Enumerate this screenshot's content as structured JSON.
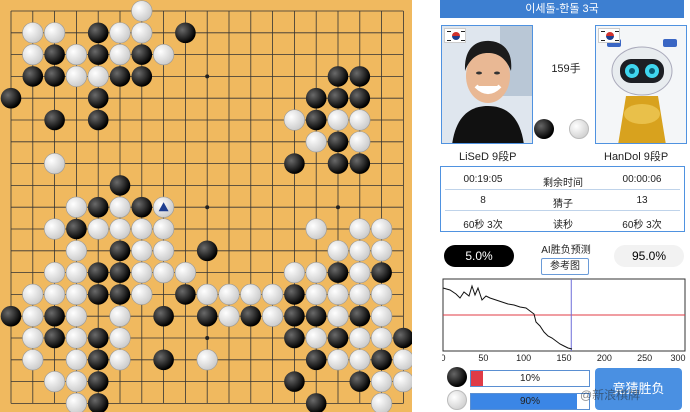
{
  "header": {
    "title": "이세돌-한돌 3국"
  },
  "move": {
    "label": "159手"
  },
  "players": {
    "black": {
      "name": "LiSeD 9段P"
    },
    "white": {
      "name": "HanDol 9段P"
    }
  },
  "stats": {
    "rows": [
      {
        "left": "00:19:05",
        "label": "剩余时间",
        "right": "00:00:06"
      },
      {
        "left": "8",
        "label": "猜子",
        "right": "13"
      },
      {
        "left": "60秒 3次",
        "label": "读秒",
        "right": "60秒 3次"
      }
    ]
  },
  "ai": {
    "title": "AI胜负预测",
    "ref_button": "参考图",
    "black_pct": "5.0%",
    "white_pct": "95.0%"
  },
  "graph": {
    "x_ticks": [
      "0",
      "50",
      "100",
      "150",
      "200",
      "250",
      "300"
    ],
    "xlim": [
      0,
      300
    ],
    "current_move": 159
  },
  "bars": {
    "black": {
      "text": "10%",
      "value": 0.1
    },
    "white": {
      "text": "90%",
      "value": 0.9
    }
  },
  "predict_button": "竞猜胜负",
  "watermark": "@新浪棋牌",
  "colors": {
    "title_bar": "#3d7fd1",
    "accent_blue": "#4a90e2",
    "board": "#f0b95f",
    "red_line": "#e03b46"
  },
  "board": {
    "size": 19,
    "last_move": [
      7,
      9
    ],
    "black": [
      [
        4,
        1
      ],
      [
        8,
        1
      ],
      [
        2,
        2
      ],
      [
        4,
        2
      ],
      [
        6,
        2
      ],
      [
        1,
        3
      ],
      [
        2,
        3
      ],
      [
        5,
        3
      ],
      [
        6,
        3
      ],
      [
        15,
        3
      ],
      [
        16,
        3
      ],
      [
        0,
        4
      ],
      [
        4,
        4
      ],
      [
        14,
        4
      ],
      [
        15,
        4
      ],
      [
        16,
        4
      ],
      [
        2,
        5
      ],
      [
        4,
        5
      ],
      [
        14,
        5
      ],
      [
        15,
        6
      ],
      [
        13,
        7
      ],
      [
        15,
        7
      ],
      [
        16,
        7
      ],
      [
        5,
        8
      ],
      [
        4,
        9
      ],
      [
        6,
        9
      ],
      [
        3,
        10
      ],
      [
        9,
        11
      ],
      [
        5,
        11
      ],
      [
        4,
        12
      ],
      [
        5,
        12
      ],
      [
        15,
        12
      ],
      [
        17,
        12
      ],
      [
        4,
        13
      ],
      [
        5,
        13
      ],
      [
        8,
        13
      ],
      [
        13,
        13
      ],
      [
        0,
        14
      ],
      [
        2,
        14
      ],
      [
        7,
        14
      ],
      [
        9,
        14
      ],
      [
        11,
        14
      ],
      [
        13,
        14
      ],
      [
        14,
        14
      ],
      [
        16,
        14
      ],
      [
        2,
        15
      ],
      [
        4,
        15
      ],
      [
        13,
        15
      ],
      [
        15,
        15
      ],
      [
        18,
        15
      ],
      [
        4,
        16
      ],
      [
        7,
        16
      ],
      [
        14,
        16
      ],
      [
        17,
        16
      ],
      [
        4,
        17
      ],
      [
        13,
        17
      ],
      [
        16,
        17
      ],
      [
        4,
        18
      ],
      [
        14,
        18
      ]
    ],
    "white": [
      [
        6,
        0
      ],
      [
        1,
        1
      ],
      [
        2,
        1
      ],
      [
        5,
        1
      ],
      [
        6,
        1
      ],
      [
        1,
        2
      ],
      [
        3,
        2
      ],
      [
        5,
        2
      ],
      [
        7,
        2
      ],
      [
        3,
        3
      ],
      [
        4,
        3
      ],
      [
        16,
        5
      ],
      [
        13,
        5
      ],
      [
        16,
        6
      ],
      [
        14,
        6
      ],
      [
        15,
        5
      ],
      [
        2,
        7
      ],
      [
        3,
        9
      ],
      [
        4,
        10
      ],
      [
        5,
        10
      ],
      [
        6,
        10
      ],
      [
        7,
        10
      ],
      [
        2,
        10
      ],
      [
        3,
        11
      ],
      [
        5,
        9
      ],
      [
        6,
        11
      ],
      [
        7,
        11
      ],
      [
        14,
        10
      ],
      [
        16,
        10
      ],
      [
        17,
        10
      ],
      [
        15,
        11
      ],
      [
        16,
        11
      ],
      [
        17,
        11
      ],
      [
        2,
        12
      ],
      [
        3,
        12
      ],
      [
        6,
        12
      ],
      [
        7,
        12
      ],
      [
        8,
        12
      ],
      [
        13,
        12
      ],
      [
        14,
        12
      ],
      [
        16,
        12
      ],
      [
        1,
        13
      ],
      [
        2,
        13
      ],
      [
        3,
        13
      ],
      [
        6,
        13
      ],
      [
        9,
        13
      ],
      [
        10,
        13
      ],
      [
        11,
        13
      ],
      [
        12,
        13
      ],
      [
        14,
        13
      ],
      [
        15,
        13
      ],
      [
        16,
        13
      ],
      [
        17,
        13
      ],
      [
        1,
        14
      ],
      [
        3,
        14
      ],
      [
        5,
        14
      ],
      [
        10,
        14
      ],
      [
        12,
        14
      ],
      [
        15,
        14
      ],
      [
        17,
        14
      ],
      [
        1,
        15
      ],
      [
        3,
        15
      ],
      [
        5,
        15
      ],
      [
        14,
        15
      ],
      [
        16,
        15
      ],
      [
        17,
        15
      ],
      [
        1,
        16
      ],
      [
        3,
        16
      ],
      [
        5,
        16
      ],
      [
        9,
        16
      ],
      [
        15,
        16
      ],
      [
        16,
        16
      ],
      [
        18,
        16
      ],
      [
        2,
        17
      ],
      [
        3,
        17
      ],
      [
        17,
        17
      ],
      [
        18,
        17
      ],
      [
        3,
        18
      ],
      [
        17,
        18
      ]
    ]
  }
}
